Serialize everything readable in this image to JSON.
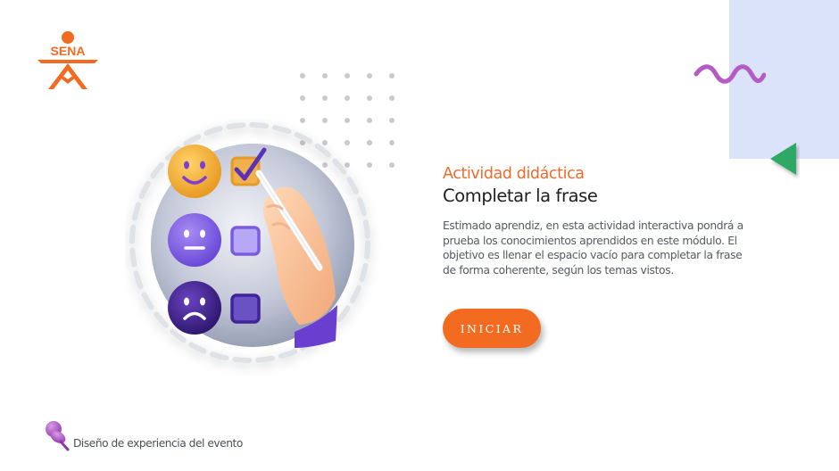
{
  "brand": {
    "logo_text": "SENA",
    "logo_color": "#f36b21"
  },
  "activity": {
    "eyebrow": "Actividad didáctica",
    "title": "Completar la frase",
    "description": "Estimado aprendiz, en esta actividad interactiva pondrá a prueba los conocimientos aprendidos en este módulo.  El objetivo es llenar el espacio vacío para completar la frase de forma coherente, según los temas vistos."
  },
  "actions": {
    "start_label": "INICIAR"
  },
  "footer": {
    "icon": "pushpin-icon",
    "label": "Diseño de experiencia del evento"
  },
  "illustration": {
    "icons": [
      "happy-face-icon",
      "neutral-face-icon",
      "sad-face-icon",
      "checkbox-checked-icon",
      "checkbox-empty-icon",
      "hand-with-pen-icon"
    ]
  },
  "colors": {
    "accent": "#f36b21",
    "panel": "#dbe3fb",
    "wave": "#b45cc4",
    "triangle": "#2fa865",
    "text_dark": "#1d1d1d",
    "text_body": "#555a60"
  }
}
